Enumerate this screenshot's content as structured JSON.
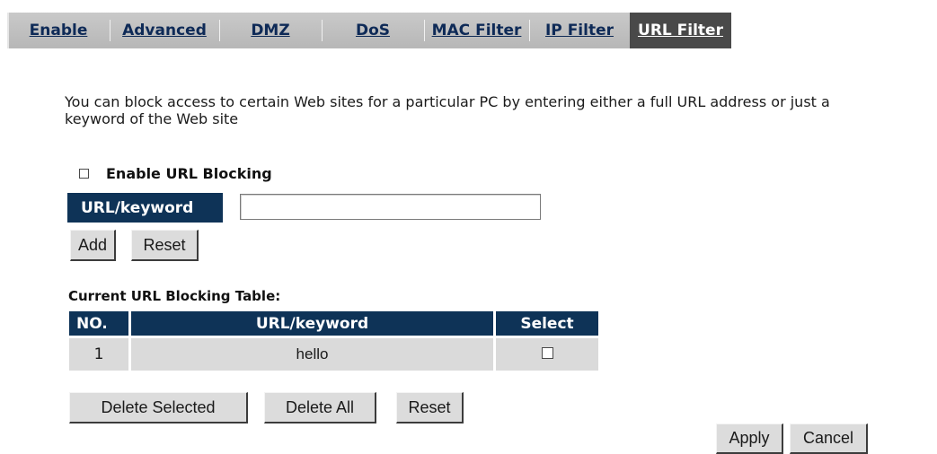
{
  "tabs": [
    {
      "label": "Enable",
      "active": false
    },
    {
      "label": "Advanced",
      "active": false
    },
    {
      "label": "DMZ",
      "active": false
    },
    {
      "label": "DoS",
      "active": false
    },
    {
      "label": "MAC Filter",
      "active": false
    },
    {
      "label": "IP Filter",
      "active": false
    },
    {
      "label": "URL Filter",
      "active": true
    }
  ],
  "description": "You can block access to certain Web sites for a particular PC by entering either a full URL address or just a keyword of the Web site",
  "enable_blocking": {
    "label": "Enable URL Blocking",
    "checked": false
  },
  "url_field": {
    "label": "URL/keyword",
    "value": ""
  },
  "buttons": {
    "add": "Add",
    "reset_entry": "Reset",
    "delete_selected": "Delete Selected",
    "delete_all": "Delete All",
    "reset_table": "Reset",
    "apply": "Apply",
    "cancel": "Cancel"
  },
  "table": {
    "caption": "Current URL Blocking Table:",
    "headers": {
      "no": "NO.",
      "url": "URL/keyword",
      "select": "Select"
    },
    "rows": [
      {
        "no": "1",
        "url": "hello",
        "selected": false
      }
    ]
  },
  "colors": {
    "tab_bar": "#bebebe",
    "tab_active": "#494949",
    "tab_link": "#0e2a57",
    "header_navy": "#0e3357",
    "row_gray": "#dadada"
  }
}
